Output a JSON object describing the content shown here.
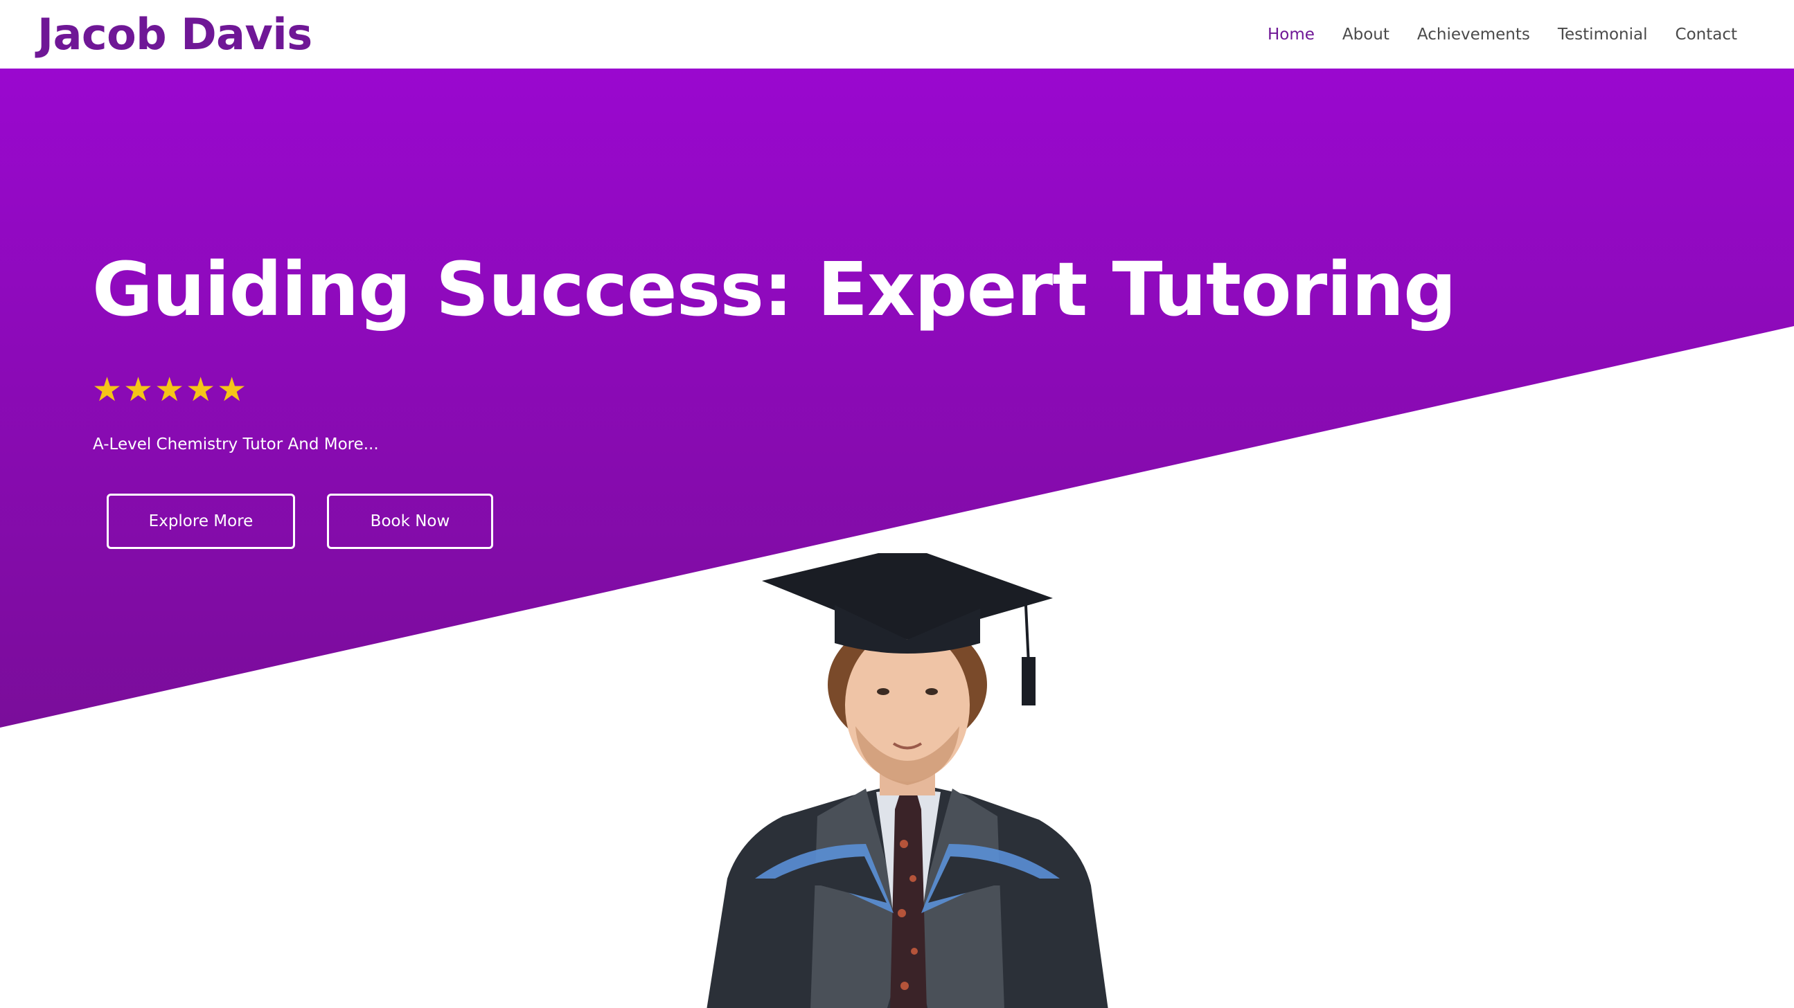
{
  "header": {
    "logo": "Jacob Davis",
    "nav": [
      "Home",
      "About",
      "Achievements",
      "Testimonial",
      "Contact"
    ],
    "active": "Home"
  },
  "hero": {
    "title": "Guiding Success: Expert Tutoring",
    "rating": {
      "value": 5,
      "max": 5
    },
    "star_color": "#f5c518",
    "subtitle": "A-Level Chemistry Tutor And More...",
    "buttons": {
      "explore": "Explore More",
      "book": "Book Now"
    }
  },
  "colors": {
    "brand": "#6f1796",
    "hero_top": "#9a08cf",
    "hero_bottom": "#7a0d9a"
  }
}
